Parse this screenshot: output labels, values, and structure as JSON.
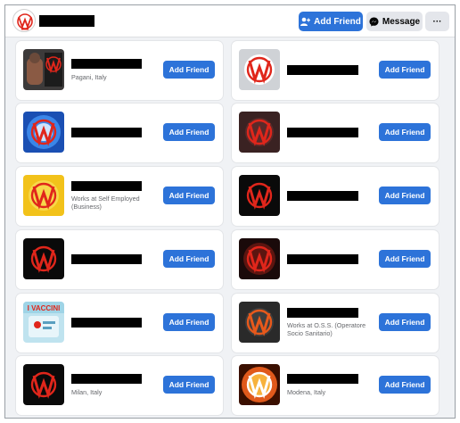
{
  "header": {
    "page_name": "",
    "add_friend_label": "Add Friend",
    "message_label": "Message",
    "more_label": "···"
  },
  "friends": [
    {
      "name": "",
      "subtitle": "Pagani, Italy",
      "button": "Add Friend",
      "avatar": "warrior-with-w-logo"
    },
    {
      "name": "",
      "subtitle": "",
      "button": "Add Friend",
      "avatar": "red-w-logo-grey-background"
    },
    {
      "name": "",
      "subtitle": "",
      "button": "Add Friend",
      "avatar": "w-logo-blue-burst"
    },
    {
      "name": "",
      "subtitle": "",
      "button": "Add Friend",
      "avatar": "red-w-logo-dark"
    },
    {
      "name": "",
      "subtitle": "Works at Self Employed (Business)",
      "button": "Add Friend",
      "avatar": "red-w-logo-yellow"
    },
    {
      "name": "",
      "subtitle": "",
      "button": "Add Friend",
      "avatar": "red-w-logo-black"
    },
    {
      "name": "",
      "subtitle": "",
      "button": "Add Friend",
      "avatar": "red-w-logo-black"
    },
    {
      "name": "",
      "subtitle": "",
      "button": "Add Friend",
      "avatar": "red-w-logo-glow"
    },
    {
      "name": "",
      "subtitle": "",
      "button": "Add Friend",
      "avatar": "i-vaccini-poster"
    },
    {
      "name": "",
      "subtitle": "Works at O.S.S. (Operatore Socio Sanitario)",
      "button": "Add Friend",
      "avatar": "w-logo-dark-circle"
    },
    {
      "name": "",
      "subtitle": "Milan, Italy",
      "button": "Add Friend",
      "avatar": "red-w-logo-black"
    },
    {
      "name": "",
      "subtitle": "Modena, Italy",
      "button": "Add Friend",
      "avatar": "w-logo-fire-burst"
    }
  ],
  "poster_text": "I VACCINI",
  "colors": {
    "accent_blue": "#2d73d9",
    "logo_red": "#e0261b",
    "page_background": "#f0f2f5"
  }
}
